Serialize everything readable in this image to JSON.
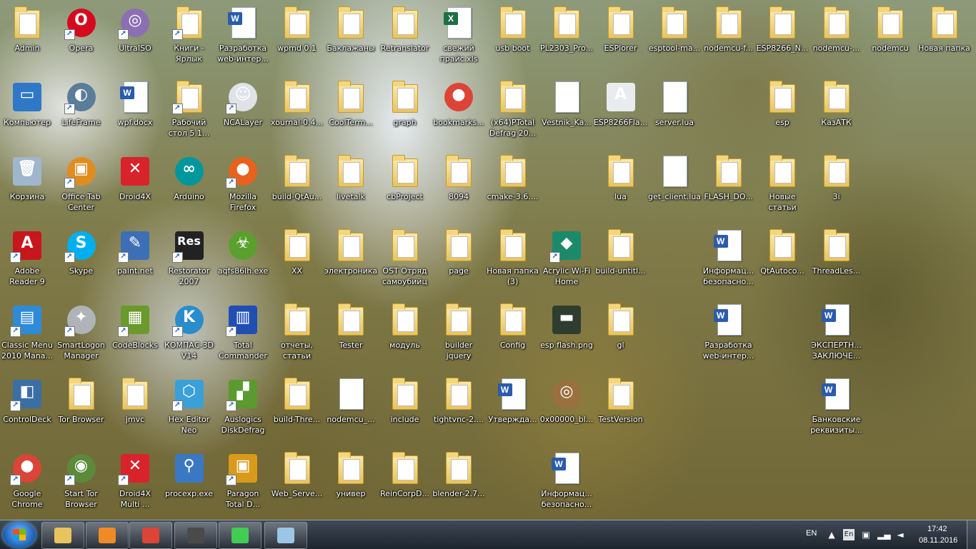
{
  "desktop": {
    "icons": [
      {
        "label": "Admin",
        "kind": "folder",
        "col": 0,
        "row": 0
      },
      {
        "label": "Opera",
        "kind": "circle",
        "color": "#d50a1e",
        "char": "O",
        "col": 1,
        "row": 0,
        "shortcut": true
      },
      {
        "label": "UltraISO",
        "kind": "circle",
        "color": "#8c6fb3",
        "char": "◎",
        "col": 2,
        "row": 0,
        "shortcut": true
      },
      {
        "label": "Книги -\nЯрлык",
        "kind": "folder",
        "col": 3,
        "row": 0,
        "shortcut": true
      },
      {
        "label": "Разработка\nweb-интер...",
        "kind": "doc",
        "tag": "W",
        "tagColor": "#2b5cab",
        "col": 4,
        "row": 0
      },
      {
        "label": "wpmd 0.1",
        "kind": "folder",
        "col": 5,
        "row": 0
      },
      {
        "label": "Баклажаны",
        "kind": "folder",
        "col": 6,
        "row": 0
      },
      {
        "label": "Retranslator",
        "kind": "folder",
        "col": 7,
        "row": 0
      },
      {
        "label": "свежий\nпрайс.xls",
        "kind": "doc",
        "tag": "X",
        "tagColor": "#1d7044",
        "col": 8,
        "row": 0
      },
      {
        "label": "usb boot",
        "kind": "folder",
        "col": 9,
        "row": 0
      },
      {
        "label": "PL2303_Pro...",
        "kind": "folder",
        "col": 10,
        "row": 0
      },
      {
        "label": "ESPlorer",
        "kind": "folder",
        "col": 11,
        "row": 0
      },
      {
        "label": "esptool-ma...",
        "kind": "folder",
        "col": 12,
        "row": 0
      },
      {
        "label": "nodemcu-f...",
        "kind": "folder",
        "col": 13,
        "row": 0
      },
      {
        "label": "ESP8266_N...",
        "kind": "folder",
        "col": 14,
        "row": 0
      },
      {
        "label": "nodemcu-...",
        "kind": "folder",
        "col": 15,
        "row": 0
      },
      {
        "label": "nodemcu",
        "kind": "folder",
        "col": 16,
        "row": 0
      },
      {
        "label": "Новая папка",
        "kind": "folder",
        "col": 17,
        "row": 0
      },
      {
        "label": "Компьютер",
        "kind": "square",
        "color": "#2f78c8",
        "char": "▭",
        "col": 0,
        "row": 1
      },
      {
        "label": "LifeFrame",
        "kind": "circle",
        "color": "#5a7d9a",
        "char": "◐",
        "col": 1,
        "row": 1,
        "shortcut": true
      },
      {
        "label": "wpf.docx",
        "kind": "doc",
        "tag": "W",
        "tagColor": "#2b5cab",
        "col": 2,
        "row": 1
      },
      {
        "label": "Рабочий\nстол 5.1...",
        "kind": "folder",
        "col": 3,
        "row": 1,
        "shortcut": true
      },
      {
        "label": "NCALayer",
        "kind": "circle",
        "color": "#dfe3e8",
        "char": "☺",
        "col": 4,
        "row": 1,
        "shortcut": true
      },
      {
        "label": "xournal-0.4...",
        "kind": "folder",
        "col": 5,
        "row": 1
      },
      {
        "label": "CoolTerm...",
        "kind": "folder",
        "col": 6,
        "row": 1
      },
      {
        "label": "graph",
        "kind": "folder",
        "col": 7,
        "row": 1
      },
      {
        "label": "bookmarks...",
        "kind": "circle",
        "color": "#db4437",
        "char": "●",
        "col": 8,
        "row": 1
      },
      {
        "label": "(x64)PTotal\nDefrag 20...",
        "kind": "folder",
        "col": 9,
        "row": 1
      },
      {
        "label": "Vestnik_Ka...",
        "kind": "doc",
        "tag": "",
        "tagColor": "transparent",
        "col": 10,
        "row": 1
      },
      {
        "label": "ESP8266Fla...",
        "kind": "square",
        "color": "#e9ecef",
        "char": "A",
        "col": 11,
        "row": 1
      },
      {
        "label": "server.lua",
        "kind": "doc",
        "tag": "",
        "tagColor": "transparent",
        "col": 12,
        "row": 1
      },
      {
        "label": "esp",
        "kind": "folder",
        "col": 14,
        "row": 1
      },
      {
        "label": "КазАТК",
        "kind": "folder",
        "col": 15,
        "row": 1
      },
      {
        "label": "Корзина",
        "kind": "square",
        "color": "#9fb6cc",
        "char": "🗑",
        "col": 0,
        "row": 2
      },
      {
        "label": "Office Tab\nCenter",
        "kind": "circle",
        "color": "#e08d20",
        "char": "▣",
        "col": 1,
        "row": 2,
        "shortcut": true
      },
      {
        "label": "Droid4X",
        "kind": "square",
        "color": "#d8232a",
        "char": "✕",
        "col": 2,
        "row": 2
      },
      {
        "label": "Arduino",
        "kind": "circle",
        "color": "#00979c",
        "char": "∞",
        "col": 3,
        "row": 2
      },
      {
        "label": "Mozilla\nFirefox",
        "kind": "circle",
        "color": "#e8621d",
        "char": "●",
        "col": 4,
        "row": 2,
        "shortcut": true
      },
      {
        "label": "build-QtAu...",
        "kind": "folder",
        "col": 5,
        "row": 2
      },
      {
        "label": "livetalk",
        "kind": "folder",
        "col": 6,
        "row": 2
      },
      {
        "label": "cbProject",
        "kind": "folder",
        "col": 7,
        "row": 2
      },
      {
        "label": "8094",
        "kind": "folder",
        "col": 8,
        "row": 2
      },
      {
        "label": "cmake-3.6....",
        "kind": "folder",
        "col": 9,
        "row": 2
      },
      {
        "label": "lua",
        "kind": "folder",
        "col": 11,
        "row": 2
      },
      {
        "label": "get_client.lua",
        "kind": "doc",
        "tag": "",
        "tagColor": "transparent",
        "col": 12,
        "row": 2
      },
      {
        "label": "FLASH_DO...",
        "kind": "folder",
        "col": 13,
        "row": 2
      },
      {
        "label": "Новые\nстатьи",
        "kind": "folder",
        "col": 14,
        "row": 2
      },
      {
        "label": "3i",
        "kind": "folder",
        "col": 15,
        "row": 2
      },
      {
        "label": "Adobe\nReader 9",
        "kind": "square",
        "color": "#c8161d",
        "char": "A",
        "col": 0,
        "row": 3,
        "shortcut": true
      },
      {
        "label": "Skype",
        "kind": "circle",
        "color": "#00aff0",
        "char": "S",
        "col": 1,
        "row": 3,
        "shortcut": true
      },
      {
        "label": "paint.net",
        "kind": "square",
        "color": "#3d6fb6",
        "char": "✎",
        "col": 2,
        "row": 3,
        "shortcut": true
      },
      {
        "label": "Restorator\n2007",
        "kind": "square",
        "color": "#222",
        "char": "Res",
        "col": 3,
        "row": 3,
        "shortcut": true
      },
      {
        "label": "aqfs86lh.exe",
        "kind": "circle",
        "color": "#5aa02c",
        "char": "☣",
        "col": 4,
        "row": 3
      },
      {
        "label": "XX",
        "kind": "folder",
        "col": 5,
        "row": 3
      },
      {
        "label": "электроника",
        "kind": "folder",
        "col": 6,
        "row": 3
      },
      {
        "label": "OST Отряд\nсамоубийц",
        "kind": "folder",
        "col": 7,
        "row": 3
      },
      {
        "label": "page",
        "kind": "folder",
        "col": 8,
        "row": 3
      },
      {
        "label": "Новая папка\n(3)",
        "kind": "folder",
        "col": 9,
        "row": 3
      },
      {
        "label": "Acrylic Wi-Fi\nHome",
        "kind": "square",
        "color": "#1b8a6b",
        "char": "◆",
        "col": 10,
        "row": 3,
        "shortcut": true
      },
      {
        "label": "build-untitl...",
        "kind": "folder",
        "col": 11,
        "row": 3
      },
      {
        "label": "Информац...\nбезопасно...",
        "kind": "doc",
        "tag": "W",
        "tagColor": "#2b5cab",
        "col": 13,
        "row": 3
      },
      {
        "label": "QtAutoco...",
        "kind": "folder",
        "col": 14,
        "row": 3
      },
      {
        "label": "ThreadLes...",
        "kind": "folder",
        "col": 15,
        "row": 3
      },
      {
        "label": "Classic Menu\n2010 Mana...",
        "kind": "square",
        "color": "#2f8ad8",
        "char": "▤",
        "col": 0,
        "row": 4,
        "shortcut": true
      },
      {
        "label": "SmartLogon\nManager",
        "kind": "circle",
        "color": "#b0b4b8",
        "char": "✦",
        "col": 1,
        "row": 4,
        "shortcut": true
      },
      {
        "label": "CodeBlocks",
        "kind": "square",
        "color": "#6a9a2b",
        "char": "▦",
        "col": 2,
        "row": 4,
        "shortcut": true
      },
      {
        "label": "КОМПАС-3D\nV14",
        "kind": "circle",
        "color": "#2a8ccc",
        "char": "K",
        "col": 3,
        "row": 4,
        "shortcut": true
      },
      {
        "label": "Total\nCommander",
        "kind": "square",
        "color": "#1f4fb3",
        "char": "▥",
        "col": 4,
        "row": 4,
        "shortcut": true
      },
      {
        "label": "отчеты,\nстатьи",
        "kind": "folder",
        "col": 5,
        "row": 4
      },
      {
        "label": "Tester",
        "kind": "folder",
        "col": 6,
        "row": 4
      },
      {
        "label": "модуль",
        "kind": "folder",
        "col": 7,
        "row": 4
      },
      {
        "label": "builder\njquery",
        "kind": "folder",
        "col": 8,
        "row": 4
      },
      {
        "label": "Config",
        "kind": "folder",
        "col": 9,
        "row": 4
      },
      {
        "label": "esp flash.png",
        "kind": "square",
        "color": "#2f3d2f",
        "char": "▬",
        "col": 10,
        "row": 4
      },
      {
        "label": "gl",
        "kind": "folder",
        "col": 11,
        "row": 4
      },
      {
        "label": "Разработка\nweb-интер...",
        "kind": "doc",
        "tag": "W",
        "tagColor": "#2b5cab",
        "col": 13,
        "row": 4
      },
      {
        "label": "ЭКСПЕРТН...\nЗАКЛЮЧЕ...",
        "kind": "doc",
        "tag": "W",
        "tagColor": "#2b5cab",
        "col": 15,
        "row": 4
      },
      {
        "label": "ControlDeck",
        "kind": "square",
        "color": "#3b6ea5",
        "char": "◧",
        "col": 0,
        "row": 5,
        "shortcut": true
      },
      {
        "label": "Tor Browser",
        "kind": "folder",
        "col": 1,
        "row": 5
      },
      {
        "label": "jmvc",
        "kind": "folder",
        "col": 2,
        "row": 5
      },
      {
        "label": "Hex Editor\nNeo",
        "kind": "square",
        "color": "#3aa0d8",
        "char": "⬡",
        "col": 3,
        "row": 5,
        "shortcut": true
      },
      {
        "label": "Auslogics\nDiskDefrag",
        "kind": "square",
        "color": "#5b9a2f",
        "char": "▞",
        "col": 4,
        "row": 5,
        "shortcut": true
      },
      {
        "label": "build-Thre...",
        "kind": "folder",
        "col": 5,
        "row": 5
      },
      {
        "label": "nodemcu_...",
        "kind": "doc",
        "tag": "",
        "tagColor": "transparent",
        "col": 6,
        "row": 5
      },
      {
        "label": "include",
        "kind": "folder",
        "col": 7,
        "row": 5
      },
      {
        "label": "tightvnc-2....",
        "kind": "folder",
        "col": 8,
        "row": 5
      },
      {
        "label": "Утвержда...",
        "kind": "doc",
        "tag": "W",
        "tagColor": "#2b5cab",
        "col": 9,
        "row": 5
      },
      {
        "label": "0x00000_bl...",
        "kind": "circle",
        "color": "#9a7040",
        "char": "◎",
        "col": 10,
        "row": 5
      },
      {
        "label": "TestVersion",
        "kind": "folder",
        "col": 11,
        "row": 5
      },
      {
        "label": "Банковские\nреквизиты...",
        "kind": "doc",
        "tag": "W",
        "tagColor": "#2b5cab",
        "col": 15,
        "row": 5
      },
      {
        "label": "Google\nChrome",
        "kind": "circle",
        "color": "#db4437",
        "char": "●",
        "col": 0,
        "row": 6,
        "shortcut": true
      },
      {
        "label": "Start Tor\nBrowser",
        "kind": "circle",
        "color": "#5b8a3a",
        "char": "◉",
        "col": 1,
        "row": 6,
        "shortcut": true
      },
      {
        "label": "Droid4X\nMulti ...",
        "kind": "square",
        "color": "#d8232a",
        "char": "✕",
        "col": 2,
        "row": 6,
        "shortcut": true
      },
      {
        "label": "procexp.exe",
        "kind": "square",
        "color": "#3b78c4",
        "char": "⚲",
        "col": 3,
        "row": 6
      },
      {
        "label": "Paragon\nTotal D...",
        "kind": "square",
        "color": "#d99a1c",
        "char": "▣",
        "col": 4,
        "row": 6,
        "shortcut": true
      },
      {
        "label": "Web_Serve...",
        "kind": "folder",
        "col": 5,
        "row": 6
      },
      {
        "label": "универ",
        "kind": "folder",
        "col": 6,
        "row": 6
      },
      {
        "label": "ReinCorpD...",
        "kind": "folder",
        "col": 7,
        "row": 6
      },
      {
        "label": "blender-2.7...",
        "kind": "folder",
        "col": 8,
        "row": 6
      },
      {
        "label": "Информац...\nбезопасно...",
        "kind": "doc",
        "tag": "W",
        "tagColor": "#2b5cab",
        "col": 10,
        "row": 6
      }
    ]
  },
  "taskbar": {
    "pinned": [
      {
        "name": "explorer",
        "color": "#e9c45d"
      },
      {
        "name": "media-player",
        "color": "#f08a24"
      },
      {
        "name": "chrome",
        "color": "#db4437"
      },
      {
        "name": "sublime",
        "color": "#4a4a4a"
      },
      {
        "name": "qt-creator",
        "color": "#41cd52"
      },
      {
        "name": "notepad-app",
        "color": "#9cc6e6"
      }
    ],
    "lang": "EN",
    "lang_badge": "En",
    "time": "17:42",
    "date": "08.11.2016"
  }
}
